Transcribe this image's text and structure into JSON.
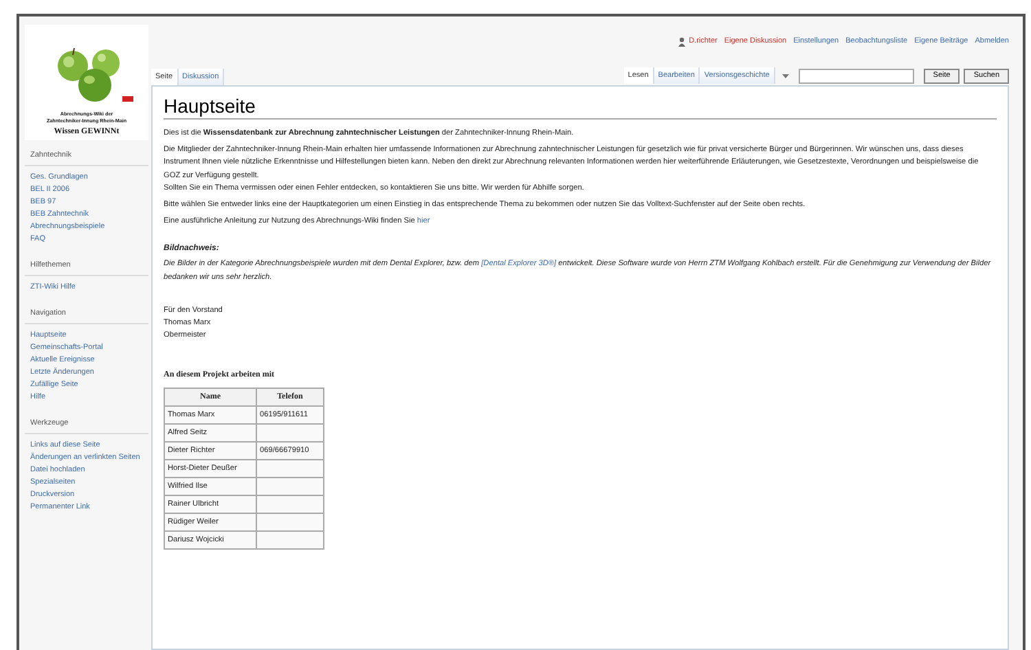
{
  "logo": {
    "lines": [
      "Abrechnungs-Wiki der",
      "Zahntechniker-Innung Rhein-Main"
    ],
    "slogan": "Wissen GEWINNt"
  },
  "personal": [
    {
      "label": "D.richter",
      "kind": "user"
    },
    {
      "label": "Eigene Diskussion",
      "kind": "new"
    },
    {
      "label": "Einstellungen",
      "kind": "link"
    },
    {
      "label": "Beobachtungsliste",
      "kind": "link"
    },
    {
      "label": "Eigene Beiträge",
      "kind": "link"
    },
    {
      "label": "Abmelden",
      "kind": "link"
    }
  ],
  "tabs_left": [
    {
      "label": "Seite",
      "selected": true
    },
    {
      "label": "Diskussion",
      "selected": false
    }
  ],
  "tabs_right": [
    {
      "label": "Lesen",
      "selected": true
    },
    {
      "label": "Bearbeiten",
      "selected": false
    },
    {
      "label": "Versionsgeschichte",
      "selected": false
    }
  ],
  "search": {
    "buttons": [
      "Seite",
      "Suchen"
    ]
  },
  "sidebar": [
    {
      "heading": "Zahntechnik",
      "items": [
        "Ges. Grundlagen",
        "BEL II 2006",
        "BEB 97",
        "BEB Zahntechnik",
        "Abrechnungsbeispiele",
        "FAQ"
      ]
    },
    {
      "heading": "Hilfethemen",
      "items": [
        "ZTI-Wiki Hilfe"
      ]
    },
    {
      "heading": "Navigation",
      "items": [
        "Hauptseite",
        "Gemeinschafts-Portal",
        "Aktuelle Ereignisse",
        "Letzte Änderungen",
        "Zufällige Seite",
        "Hilfe"
      ]
    },
    {
      "heading": "Werkzeuge",
      "items": [
        "Links auf diese Seite",
        "Änderungen an verlinkten Seiten",
        "Datei hochladen",
        "Spezialseiten",
        "Druckversion",
        "Permanenter Link"
      ]
    }
  ],
  "page": {
    "title": "Hauptseite",
    "blocks": [
      {
        "kind": "para",
        "text": "Dies ist die **Wissensdatenbank zur Abrechnung zahntechnischer Leistungen** der Zahntechniker-Innung Rhein-Main."
      },
      {
        "kind": "para",
        "text": "Die Mitglieder der Zahntechniker-Innung Rhein-Main erhalten hier umfassende Informationen zur Abrechnung zahntechnischer Leistungen für gesetzlich wie für privat versicherte Bürger und Bürgerinnen. Wir wünschen uns, dass dieses Instrument Ihnen viele nützliche Erkenntnisse und Hilfestellungen bieten kann. Neben den direkt zur Abrechnung relevanten Informationen werden hier weiterführende Erläuterungen, wie Gesetzestexte, Verordnungen und beispielsweise die GOZ zur Verfügung gestellt."
      },
      {
        "kind": "line",
        "text": "Sollten Sie ein Thema vermissen oder einen Fehler entdecken, so kontaktieren Sie uns bitte. Wir werden für Abhilfe sorgen."
      },
      {
        "kind": "para",
        "text": "Bitte wählen Sie entweder links eine der Hauptkategorien um einen Einstieg in das entsprechende Thema zu bekommen oder nutzen Sie das Volltext-Suchfenster auf der Seite oben rechts."
      },
      {
        "kind": "linkpara",
        "text": "Eine ausführliche Anleitung zur Nutzung des Abrechnungs-Wiki finden Sie ",
        "link": "hier"
      },
      {
        "kind": "heading",
        "text": "Bildnachweis:"
      },
      {
        "kind": "italiclink",
        "text": "Die Bilder in der Kategorie Abrechnungsbeispiele wurden mit dem Dental Explorer, bzw. dem ",
        "link": "[Dental Explorer 3D®]",
        "after": " entwickelt. Diese Software wurde von Herrn ZTM Wolfgang Kohlbach erstellt. Für die Genehmigung zur Verwendung der Bilder bedanken wir uns sehr herzlich."
      },
      {
        "kind": "gap"
      },
      {
        "kind": "para",
        "text": "Für den Vorstand"
      },
      {
        "kind": "line",
        "text": "Thomas Marx"
      },
      {
        "kind": "line",
        "text": "Obermeister"
      },
      {
        "kind": "gap"
      },
      {
        "kind": "tablehead",
        "text": "An diesem Projekt arbeiten mit"
      }
    ],
    "table": {
      "columns": [
        "Name",
        "Telefon"
      ],
      "rows": [
        {
          "name": "Thomas Marx",
          "telefon": "06195/911611"
        },
        {
          "name": "Alfred Seitz"
        },
        {
          "name": "Dieter Richter",
          "telefon": "069/66679910"
        },
        {
          "name": "Horst-Dieter Deußer"
        },
        {
          "name": "Wilfried Ilse"
        },
        {
          "name": "Rainer Ulbricht"
        },
        {
          "name": "Rüdiger Weiler"
        },
        {
          "name": "Dariusz Wojcicki"
        }
      ]
    }
  }
}
